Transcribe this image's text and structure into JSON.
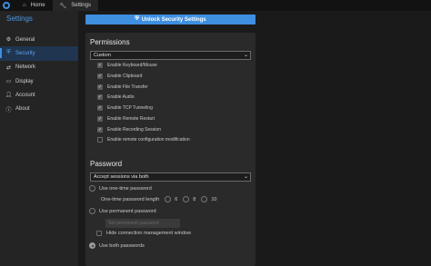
{
  "titlebar": {
    "tabs": [
      {
        "label": "Home",
        "icon": "home-icon"
      },
      {
        "label": "Settings",
        "icon": "wrench-icon",
        "active": true
      }
    ]
  },
  "sidebar": {
    "title": "Settings",
    "items": [
      {
        "label": "General",
        "icon": "gear-icon"
      },
      {
        "label": "Security",
        "icon": "shield-icon",
        "active": true
      },
      {
        "label": "Network",
        "icon": "network-icon"
      },
      {
        "label": "Display",
        "icon": "monitor-icon"
      },
      {
        "label": "Account",
        "icon": "person-icon"
      },
      {
        "label": "About",
        "icon": "info-icon"
      }
    ]
  },
  "unlock": {
    "label": "Unlock Security Settings"
  },
  "permissions": {
    "title": "Permissions",
    "preset": "Custom",
    "items": [
      {
        "label": "Enable Keyboard/Mouse",
        "checked": true
      },
      {
        "label": "Enable Clipboard",
        "checked": true
      },
      {
        "label": "Enable File Transfer",
        "checked": true
      },
      {
        "label": "Enable Audio",
        "checked": true
      },
      {
        "label": "Enable TCP Tunneling",
        "checked": true
      },
      {
        "label": "Enable Remote Restart",
        "checked": true
      },
      {
        "label": "Enable Recording Session",
        "checked": true
      },
      {
        "label": "Enable remote configuration modification",
        "checked": false
      }
    ]
  },
  "password": {
    "title": "Password",
    "mode": "Accept sessions via both",
    "one_time": "Use one-time password",
    "length_label": "One-time password length",
    "lengths": [
      "6",
      "8",
      "10"
    ],
    "permanent": "Use permanent password",
    "set_password": "Set permanent password",
    "hide_window": "Hide connection management window",
    "both": "Use both passwords"
  },
  "colors": {
    "accent": "#3e8fe0",
    "background": "#1a1a1a",
    "sidebar": "#242424",
    "card": "#2a2a2a"
  }
}
